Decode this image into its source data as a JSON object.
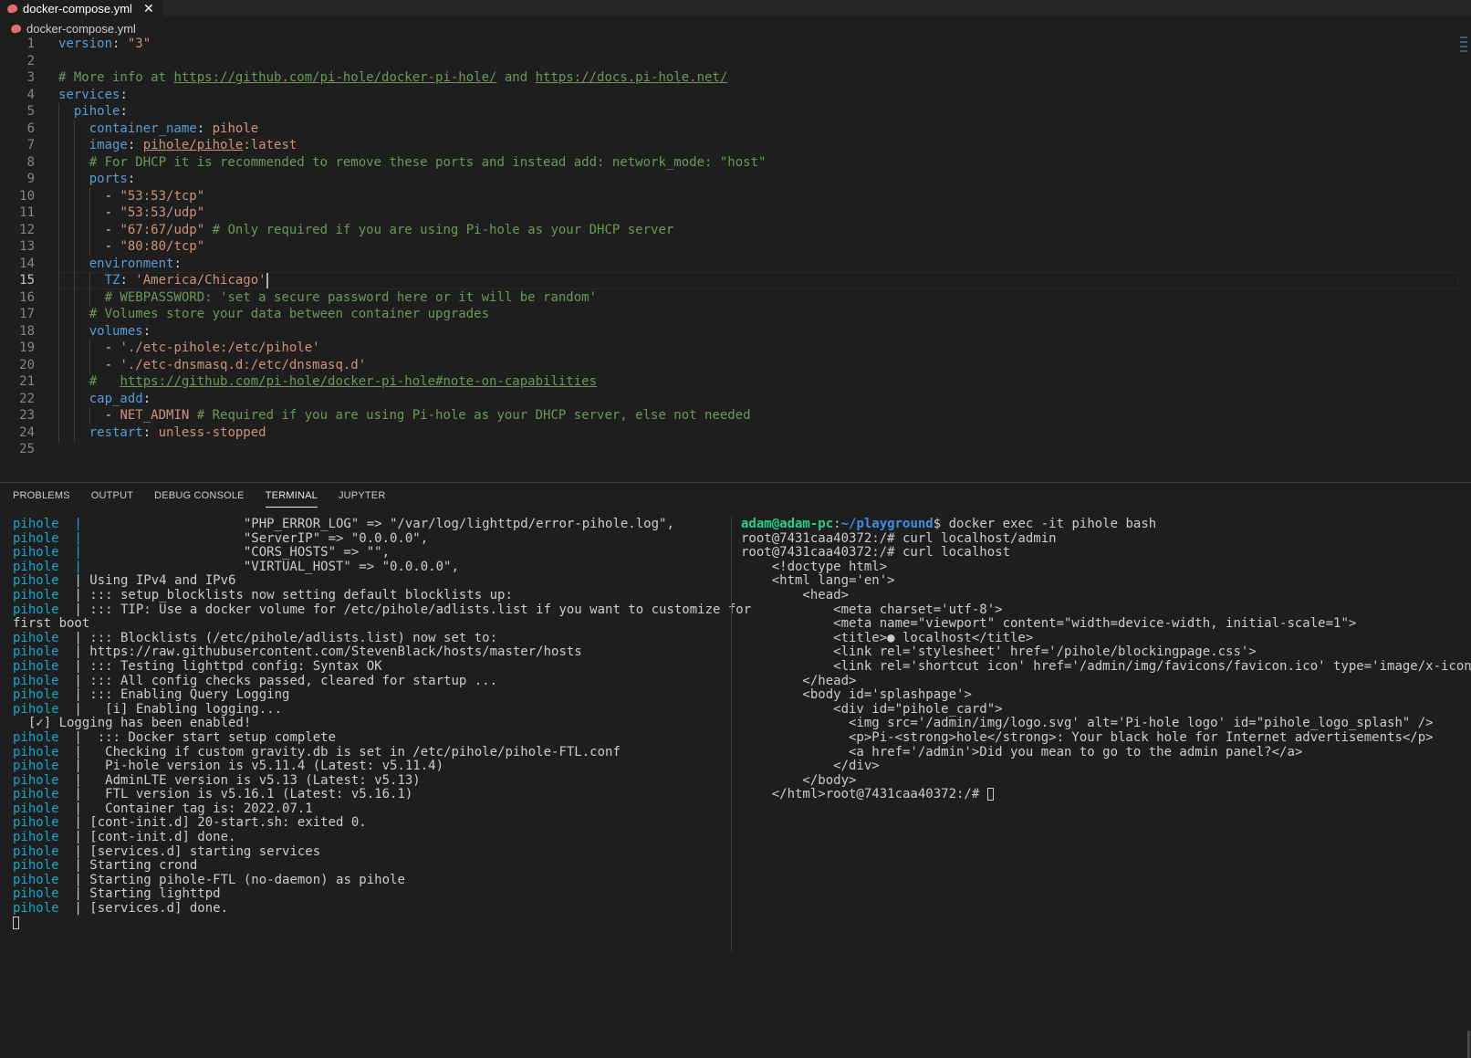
{
  "tab": {
    "filename": "docker-compose.yml",
    "close_glyph": "✕",
    "icon": "yml-file-icon"
  },
  "breadcrumb": {
    "filename": "docker-compose.yml",
    "icon": "yml-file-icon"
  },
  "editor": {
    "active_line": 15,
    "lines": [
      {
        "n": "1",
        "t": [
          [
            "k",
            "version"
          ],
          [
            "p",
            ": "
          ],
          [
            "s",
            "\"3\""
          ]
        ]
      },
      {
        "n": "2",
        "t": []
      },
      {
        "n": "3",
        "t": [
          [
            "c",
            "# More info at "
          ],
          [
            "cu",
            "https://github.com/pi-hole/docker-pi-hole/"
          ],
          [
            "c",
            " and "
          ],
          [
            "cu",
            "https://docs.pi-hole.net/"
          ]
        ]
      },
      {
        "n": "4",
        "t": [
          [
            "k",
            "services"
          ],
          [
            "p",
            ":"
          ]
        ]
      },
      {
        "n": "5",
        "t": [
          [
            "p",
            "  "
          ],
          [
            "k",
            "pihole"
          ],
          [
            "p",
            ":"
          ]
        ]
      },
      {
        "n": "6",
        "t": [
          [
            "p",
            "    "
          ],
          [
            "k",
            "container_name"
          ],
          [
            "p",
            ": "
          ],
          [
            "s",
            "pihole"
          ]
        ]
      },
      {
        "n": "7",
        "t": [
          [
            "p",
            "    "
          ],
          [
            "k",
            "image"
          ],
          [
            "p",
            ": "
          ],
          [
            "su",
            "pihole/pihole"
          ],
          [
            "s",
            ":latest"
          ]
        ]
      },
      {
        "n": "8",
        "t": [
          [
            "p",
            "    "
          ],
          [
            "c",
            "# For DHCP it is recommended to remove these ports and instead add: network_mode: \"host\""
          ]
        ]
      },
      {
        "n": "9",
        "t": [
          [
            "p",
            "    "
          ],
          [
            "k",
            "ports"
          ],
          [
            "p",
            ":"
          ]
        ]
      },
      {
        "n": "10",
        "t": [
          [
            "p",
            "      - "
          ],
          [
            "s",
            "\"53:53/tcp\""
          ]
        ]
      },
      {
        "n": "11",
        "t": [
          [
            "p",
            "      - "
          ],
          [
            "s",
            "\"53:53/udp\""
          ]
        ]
      },
      {
        "n": "12",
        "t": [
          [
            "p",
            "      - "
          ],
          [
            "s",
            "\"67:67/udp\""
          ],
          [
            "c",
            " # Only required if you are using Pi-hole as your DHCP server"
          ]
        ]
      },
      {
        "n": "13",
        "t": [
          [
            "p",
            "      - "
          ],
          [
            "s",
            "\"80:80/tcp\""
          ]
        ]
      },
      {
        "n": "14",
        "t": [
          [
            "p",
            "    "
          ],
          [
            "k",
            "environment"
          ],
          [
            "p",
            ":"
          ]
        ]
      },
      {
        "n": "15",
        "t": [
          [
            "p",
            "      "
          ],
          [
            "k",
            "TZ"
          ],
          [
            "p",
            ": "
          ],
          [
            "s",
            "'America/Chicago'"
          ],
          [
            "caret",
            ""
          ]
        ]
      },
      {
        "n": "16",
        "t": [
          [
            "p",
            "      "
          ],
          [
            "c",
            "# WEBPASSWORD: 'set a secure password here or it will be random'"
          ]
        ]
      },
      {
        "n": "17",
        "t": [
          [
            "p",
            "    "
          ],
          [
            "c",
            "# Volumes store your data between container upgrades"
          ]
        ]
      },
      {
        "n": "18",
        "t": [
          [
            "p",
            "    "
          ],
          [
            "k",
            "volumes"
          ],
          [
            "p",
            ":"
          ]
        ]
      },
      {
        "n": "19",
        "t": [
          [
            "p",
            "      - "
          ],
          [
            "s",
            "'./etc-pihole:/etc/pihole'"
          ]
        ]
      },
      {
        "n": "20",
        "t": [
          [
            "p",
            "      - "
          ],
          [
            "s",
            "'./etc-dnsmasq.d:/etc/dnsmasq.d'"
          ]
        ]
      },
      {
        "n": "21",
        "t": [
          [
            "p",
            "    "
          ],
          [
            "c",
            "#   "
          ],
          [
            "cu",
            "https://github.com/pi-hole/docker-pi-hole#note-on-capabilities"
          ]
        ]
      },
      {
        "n": "22",
        "t": [
          [
            "p",
            "    "
          ],
          [
            "k",
            "cap_add"
          ],
          [
            "p",
            ":"
          ]
        ]
      },
      {
        "n": "23",
        "t": [
          [
            "p",
            "      - "
          ],
          [
            "s",
            "NET_ADMIN"
          ],
          [
            "c",
            " # Required if you are using Pi-hole as your DHCP server, else not needed"
          ]
        ]
      },
      {
        "n": "24",
        "t": [
          [
            "p",
            "    "
          ],
          [
            "k",
            "restart"
          ],
          [
            "p",
            ": "
          ],
          [
            "s",
            "unless-stopped"
          ]
        ]
      },
      {
        "n": "25",
        "t": []
      }
    ]
  },
  "panel": {
    "tabs": [
      "PROBLEMS",
      "OUTPUT",
      "DEBUG CONSOLE",
      "TERMINAL",
      "JUPYTER"
    ],
    "active_tab": "TERMINAL"
  },
  "terminal_left": [
    [
      [
        "cy",
        "pihole  |"
      ],
      [
        "t",
        "                     \"PHP_ERROR_LOG\" => \"/var/log/lighttpd/error-pihole.log\","
      ]
    ],
    [
      [
        "cy",
        "pihole  |"
      ],
      [
        "t",
        "                     \"ServerIP\" => \"0.0.0.0\","
      ]
    ],
    [
      [
        "cy",
        "pihole  |"
      ],
      [
        "t",
        "                     \"CORS_HOSTS\" => \"\","
      ]
    ],
    [
      [
        "cy",
        "pihole  |"
      ],
      [
        "t",
        "                     \"VIRTUAL_HOST\" => \"0.0.0.0\","
      ]
    ],
    [
      [
        "cy",
        "pihole"
      ],
      [
        "t",
        "  | Using IPv4 and IPv6"
      ]
    ],
    [
      [
        "cy",
        "pihole"
      ],
      [
        "t",
        "  | ::: setup_blocklists now setting default blocklists up:"
      ]
    ],
    [
      [
        "cy",
        "pihole"
      ],
      [
        "t",
        "  | ::: TIP: Use a docker volume for /etc/pihole/adlists.list if you want to customize for"
      ]
    ],
    [
      [
        "t",
        "first boot"
      ]
    ],
    [
      [
        "cy",
        "pihole"
      ],
      [
        "t",
        "  | ::: Blocklists (/etc/pihole/adlists.list) now set to:"
      ]
    ],
    [
      [
        "cy",
        "pihole"
      ],
      [
        "t",
        "  | https://raw.githubusercontent.com/StevenBlack/hosts/master/hosts"
      ]
    ],
    [
      [
        "cy",
        "pihole"
      ],
      [
        "t",
        "  | ::: Testing lighttpd config: Syntax OK"
      ]
    ],
    [
      [
        "cy",
        "pihole"
      ],
      [
        "t",
        "  | ::: All config checks passed, cleared for startup ..."
      ]
    ],
    [
      [
        "cy",
        "pihole"
      ],
      [
        "t",
        "  | ::: Enabling Query Logging"
      ]
    ],
    [
      [
        "cy",
        "pihole"
      ],
      [
        "t",
        "  |   [i] Enabling logging..."
      ]
    ],
    [
      [
        "t",
        "  [✓] Logging has been enabled!"
      ]
    ],
    [
      [
        "cy",
        "pihole"
      ],
      [
        "t",
        "  |  ::: Docker start setup complete"
      ]
    ],
    [
      [
        "cy",
        "pihole"
      ],
      [
        "t",
        "  |   Checking if custom gravity.db is set in /etc/pihole/pihole-FTL.conf"
      ]
    ],
    [
      [
        "cy",
        "pihole"
      ],
      [
        "t",
        "  |   Pi-hole version is v5.11.4 (Latest: v5.11.4)"
      ]
    ],
    [
      [
        "cy",
        "pihole"
      ],
      [
        "t",
        "  |   AdminLTE version is v5.13 (Latest: v5.13)"
      ]
    ],
    [
      [
        "cy",
        "pihole"
      ],
      [
        "t",
        "  |   FTL version is v5.16.1 (Latest: v5.16.1)"
      ]
    ],
    [
      [
        "cy",
        "pihole"
      ],
      [
        "t",
        "  |   Container tag is: 2022.07.1"
      ]
    ],
    [
      [
        "cy",
        "pihole"
      ],
      [
        "t",
        "  | [cont-init.d] 20-start.sh: exited 0."
      ]
    ],
    [
      [
        "cy",
        "pihole"
      ],
      [
        "t",
        "  | [cont-init.d] done."
      ]
    ],
    [
      [
        "cy",
        "pihole"
      ],
      [
        "t",
        "  | [services.d] starting services"
      ]
    ],
    [
      [
        "cy",
        "pihole"
      ],
      [
        "t",
        "  | Starting crond"
      ]
    ],
    [
      [
        "cy",
        "pihole"
      ],
      [
        "t",
        "  | Starting pihole-FTL (no-daemon) as pihole"
      ]
    ],
    [
      [
        "cy",
        "pihole"
      ],
      [
        "t",
        "  | Starting lighttpd"
      ]
    ],
    [
      [
        "cy",
        "pihole"
      ],
      [
        "t",
        "  | [services.d] done."
      ]
    ],
    [
      [
        "cursor",
        ""
      ]
    ]
  ],
  "terminal_right": [
    [
      [
        "gr",
        "adam@adam-pc"
      ],
      [
        "t",
        ":"
      ],
      [
        "bl",
        "~/playground"
      ],
      [
        "t",
        "$ docker exec -it pihole bash"
      ]
    ],
    [
      [
        "t",
        "root@7431caa40372:/# curl localhost/admin"
      ]
    ],
    [
      [
        "t",
        "root@7431caa40372:/# curl localhost"
      ]
    ],
    [
      [
        "t",
        "    <!doctype html>"
      ]
    ],
    [
      [
        "t",
        "    <html lang='en'>"
      ]
    ],
    [
      [
        "t",
        "        <head>"
      ]
    ],
    [
      [
        "t",
        "            <meta charset='utf-8'>"
      ]
    ],
    [
      [
        "t",
        "            <meta name=\"viewport\" content=\"width=device-width, initial-scale=1\">"
      ]
    ],
    [
      [
        "t",
        "            <title>● localhost</title>"
      ]
    ],
    [
      [
        "t",
        "            <link rel='stylesheet' href='/pihole/blockingpage.css'>"
      ]
    ],
    [
      [
        "t",
        "            <link rel='shortcut icon' href='/admin/img/favicons/favicon.ico' type='image/x-icon'>"
      ]
    ],
    [
      [
        "t",
        "        </head>"
      ]
    ],
    [
      [
        "t",
        "        <body id='splashpage'>"
      ]
    ],
    [
      [
        "t",
        "            <div id=\"pihole_card\">"
      ]
    ],
    [
      [
        "t",
        "              <img src='/admin/img/logo.svg' alt='Pi-hole logo' id=\"pihole_logo_splash\" />"
      ]
    ],
    [
      [
        "t",
        "              <p>Pi-<strong>hole</strong>: Your black hole for Internet advertisements</p>"
      ]
    ],
    [
      [
        "t",
        "              <a href='/admin'>Did you mean to go to the admin panel?</a>"
      ]
    ],
    [
      [
        "t",
        "            </div>"
      ]
    ],
    [
      [
        "t",
        "        </body>"
      ]
    ],
    [
      [
        "t",
        "    </html>root@7431caa40372:/# "
      ],
      [
        "cursor",
        ""
      ]
    ]
  ]
}
